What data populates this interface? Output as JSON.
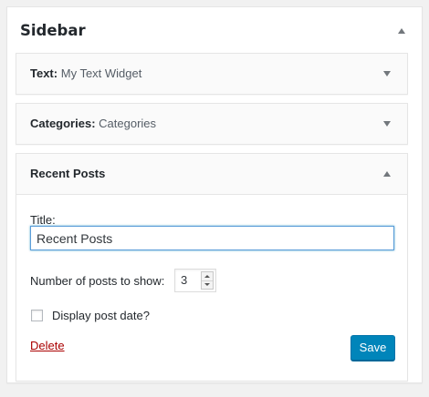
{
  "sidebar": {
    "title": "Sidebar"
  },
  "widgets": [
    {
      "label": "Text:",
      "in_title": "My Text Widget",
      "state": "collapsed"
    },
    {
      "label": "Categories:",
      "in_title": "Categories",
      "state": "collapsed"
    },
    {
      "label": "Recent Posts",
      "in_title": "",
      "state": "expanded",
      "form": {
        "title_label": "Title:",
        "title_value": "Recent Posts",
        "number_label": "Number of posts to show:",
        "number_value": "3",
        "show_date_label": "Display post date?",
        "show_date_checked": false,
        "delete_label": "Delete",
        "save_label": "Save"
      }
    }
  ],
  "colors": {
    "page_background": "#f1f1f1",
    "save_button": "#0085ba",
    "delete_link": "#aa0000",
    "focus_border": "#5b9dd9"
  }
}
